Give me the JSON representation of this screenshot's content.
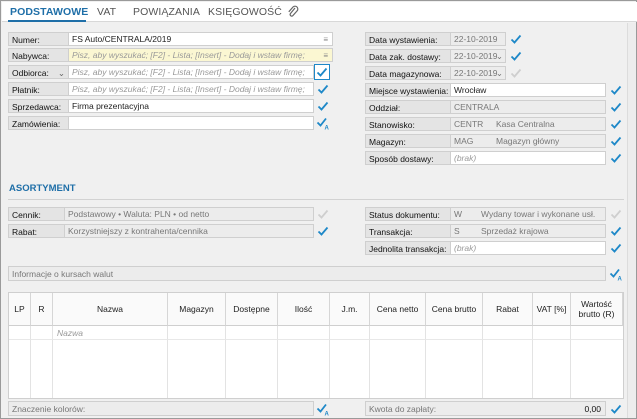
{
  "tabs": [
    {
      "label": "PODSTAWOWE",
      "active": true
    },
    {
      "label": "VAT"
    },
    {
      "label": "POWIĄZANIA"
    },
    {
      "label": "KSIĘGOWOŚĆ"
    }
  ],
  "left_form": {
    "numer": {
      "label": "Numer:",
      "value": "FS Auto/CENTRALA/2019"
    },
    "nabywca": {
      "label": "Nabywca:",
      "placeholder": "Pisz, aby wyszukać; [F2] - Lista; [Insert] - Dodaj i wstaw firmę;"
    },
    "odbiorca": {
      "label": "Odbiorca:",
      "placeholder": "Pisz, aby wyszukać; [F2] - Lista; [Insert] - Dodaj i wstaw firmę;"
    },
    "platnik": {
      "label": "Płatnik:",
      "placeholder": "Pisz, aby wyszukać; [F2] - Lista; [Insert] - Dodaj i wstaw firmę;"
    },
    "sprzedawca": {
      "label": "Sprzedawca:",
      "value": "Firma prezentacyjna"
    },
    "zamowienia": {
      "label": "Zamówienia:",
      "value": ""
    }
  },
  "right_form": {
    "data_wystawienia": {
      "label": "Data wystawienia:",
      "value": "22-10-2019"
    },
    "data_zak_dostawy": {
      "label": "Data zak. dostawy:",
      "value": "22-10-2019"
    },
    "data_magazynowa": {
      "label": "Data magazynowa:",
      "value": "22-10-2019"
    },
    "miejsce_wystawienia": {
      "label": "Miejsce wystawienia:",
      "value": "Wrocław"
    },
    "oddzial": {
      "label": "Oddział:",
      "value": "CENTRALA"
    },
    "stanowisko": {
      "label": "Stanowisko:",
      "code": "CENTR",
      "name": "Kasa Centralna"
    },
    "magazyn": {
      "label": "Magazyn:",
      "code": "MAG",
      "name": "Magazyn główny"
    },
    "sposob_dostawy": {
      "label": "Sposób dostawy:",
      "value": "(brak)"
    }
  },
  "asortyment": {
    "title": "ASORTYMENT",
    "cennik": {
      "label": "Cennik:",
      "value": "Podstawowy • Waluta: PLN • od netto"
    },
    "rabat": {
      "label": "Rabat:",
      "value": "Korzystniejszy z kontrahenta/cennika"
    },
    "status_dokumentu": {
      "label": "Status dokumentu:",
      "code": "W",
      "name": "Wydany towar i wykonane usł."
    },
    "transakcja": {
      "label": "Transakcja:",
      "code": "S",
      "name": "Sprzedaż krajowa"
    },
    "jednolita_transakcja": {
      "label": "Jednolita transakcja:",
      "value": "(brak)"
    },
    "kursy_walut": "Informacje o kursach walut"
  },
  "table": {
    "columns": [
      "LP",
      "R",
      "Nazwa",
      "Magazyn",
      "Dostępne",
      "Ilość",
      "J.m.",
      "Cena netto",
      "Cena brutto",
      "Rabat",
      "VAT [%]",
      "Wartość brutto (R)"
    ],
    "new_row_placeholder": "Nazwa"
  },
  "footer": {
    "znaczenie_kolorow": "Znaczenie kolorów:",
    "kwota_do_zaplaty": "Kwota do zapłaty:",
    "kwota_value": "0,00"
  }
}
